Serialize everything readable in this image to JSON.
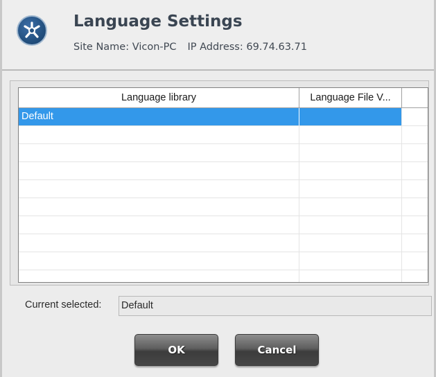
{
  "header": {
    "title": "Language Settings",
    "site_name": "Site Name: Vicon-PC",
    "ip_address": "IP Address: 69.74.63.71",
    "logo_icon": "vicon-logo-icon"
  },
  "grid": {
    "columns": [
      "Language library",
      "Language File V..."
    ],
    "rows": [
      {
        "library": "Default",
        "file_version": "",
        "selected": true
      },
      {
        "library": "",
        "file_version": ""
      },
      {
        "library": "",
        "file_version": ""
      },
      {
        "library": "",
        "file_version": ""
      },
      {
        "library": "",
        "file_version": ""
      },
      {
        "library": "",
        "file_version": ""
      },
      {
        "library": "",
        "file_version": ""
      },
      {
        "library": "",
        "file_version": ""
      },
      {
        "library": "",
        "file_version": ""
      },
      {
        "library": "",
        "file_version": ""
      }
    ],
    "selection_color": "#3398ea"
  },
  "current": {
    "label": "Current selected:",
    "value": "Default"
  },
  "buttons": {
    "ok_label": "OK",
    "cancel_label": "Cancel"
  }
}
